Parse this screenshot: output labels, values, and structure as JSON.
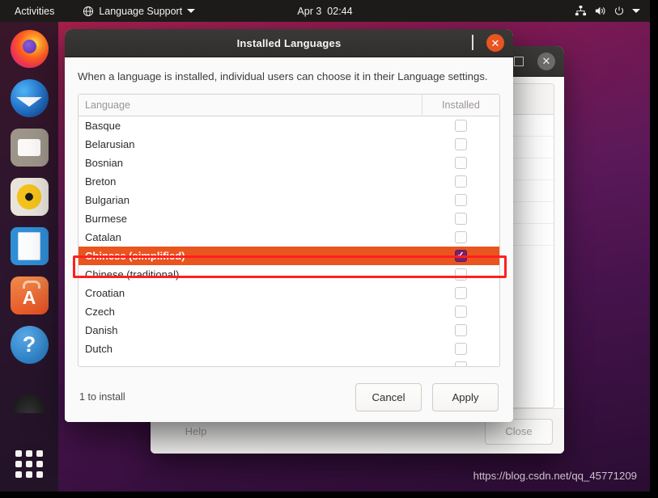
{
  "topbar": {
    "activities": "Activities",
    "app_menu": {
      "label": "Language Support",
      "icon": "globe-icon",
      "arrow": "▾"
    },
    "clock": {
      "date": "Apr 3",
      "time": "02:44"
    },
    "status_icons": [
      "network-icon",
      "volume-icon",
      "power-icon",
      "chevron-down-icon"
    ]
  },
  "dock": {
    "items": [
      {
        "name": "firefox",
        "label": "Firefox"
      },
      {
        "name": "thunderbird",
        "label": "Thunderbird Mail"
      },
      {
        "name": "files",
        "label": "Files"
      },
      {
        "name": "rhythmbox",
        "label": "Rhythmbox"
      },
      {
        "name": "libreoffice-writer",
        "label": "LibreOffice Writer"
      },
      {
        "name": "ubuntu-software",
        "label": "Ubuntu Software"
      },
      {
        "name": "help",
        "label": "Help"
      },
      {
        "name": "trash",
        "label": "Trash"
      }
    ],
    "show_apps_label": "Show Applications"
  },
  "background_window": {
    "title": "",
    "controls": {
      "maximize": "□",
      "close": "✕"
    },
    "footer": {
      "help_label": "Help",
      "close_label": "Close"
    }
  },
  "dialog": {
    "title": "Installed Languages",
    "controls": {
      "minimize": "—",
      "maximize": "□",
      "close": "✕"
    },
    "description": "When a language is installed, individual users can choose it in their Language settings.",
    "table": {
      "columns": [
        "Language",
        "Installed"
      ],
      "rows": [
        {
          "language": "Basque",
          "installed": false
        },
        {
          "language": "Belarusian",
          "installed": false
        },
        {
          "language": "Bosnian",
          "installed": false
        },
        {
          "language": "Breton",
          "installed": false
        },
        {
          "language": "Bulgarian",
          "installed": false
        },
        {
          "language": "Burmese",
          "installed": false
        },
        {
          "language": "Catalan",
          "installed": false
        },
        {
          "language": "Chinese (simplified)",
          "installed": true,
          "selected": true
        },
        {
          "language": "Chinese (traditional)",
          "installed": false
        },
        {
          "language": "Croatian",
          "installed": false
        },
        {
          "language": "Czech",
          "installed": false
        },
        {
          "language": "Danish",
          "installed": false
        },
        {
          "language": "Dutch",
          "installed": false
        }
      ]
    },
    "status": "1 to install",
    "buttons": {
      "cancel": "Cancel",
      "apply": "Apply"
    }
  },
  "annotation": {
    "color": "#ff1f1f",
    "target": "Chinese (simplified)"
  },
  "watermark": "https://blog.csdn.net/qq_45771209",
  "colors": {
    "accent_orange": "#e95420",
    "checkbox_purple": "#77216f",
    "panel_dark": "#1d1b19",
    "annotation_red": "#ff1f1f"
  }
}
